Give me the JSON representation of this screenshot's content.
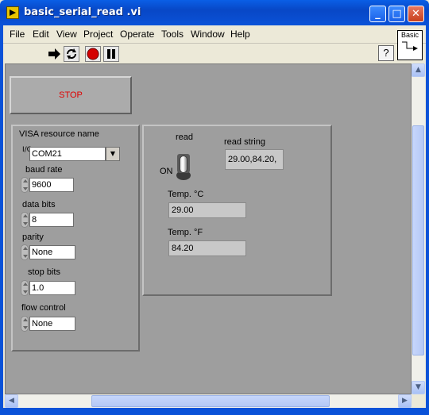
{
  "window": {
    "title": "basic_serial_read .vi"
  },
  "menu": [
    "File",
    "Edit",
    "View",
    "Project",
    "Operate",
    "Tools",
    "Window",
    "Help"
  ],
  "toolbar": {
    "basic_label": "Basic",
    "help_glyph": "?"
  },
  "stop": {
    "label": "STOP"
  },
  "serial": {
    "visa_label": "VISA resource name",
    "visa_prefix": "I/O",
    "visa_value": "COM21",
    "baud_label": "baud rate",
    "baud_value": "9600",
    "databits_label": "data bits",
    "databits_value": "8",
    "parity_label": "parity",
    "parity_value": "None",
    "stopbits_label": "stop bits",
    "stopbits_value": "1.0",
    "flow_label": "flow control",
    "flow_value": "None"
  },
  "readings": {
    "read_label": "read",
    "on_label": "ON",
    "read_string_label": "read string",
    "read_string_value": "29.00,84.20,",
    "tempc_label": "Temp. °C",
    "tempc_value": "29.00",
    "tempf_label": "Temp. °F",
    "tempf_value": "84.20"
  },
  "scroll": {
    "up": "▲",
    "down": "▼",
    "left": "◀",
    "right": "▶"
  },
  "colors": {
    "titlebar": "#0a52d8",
    "panel_bg": "#9e9e9e",
    "stop_text": "#e00000"
  }
}
